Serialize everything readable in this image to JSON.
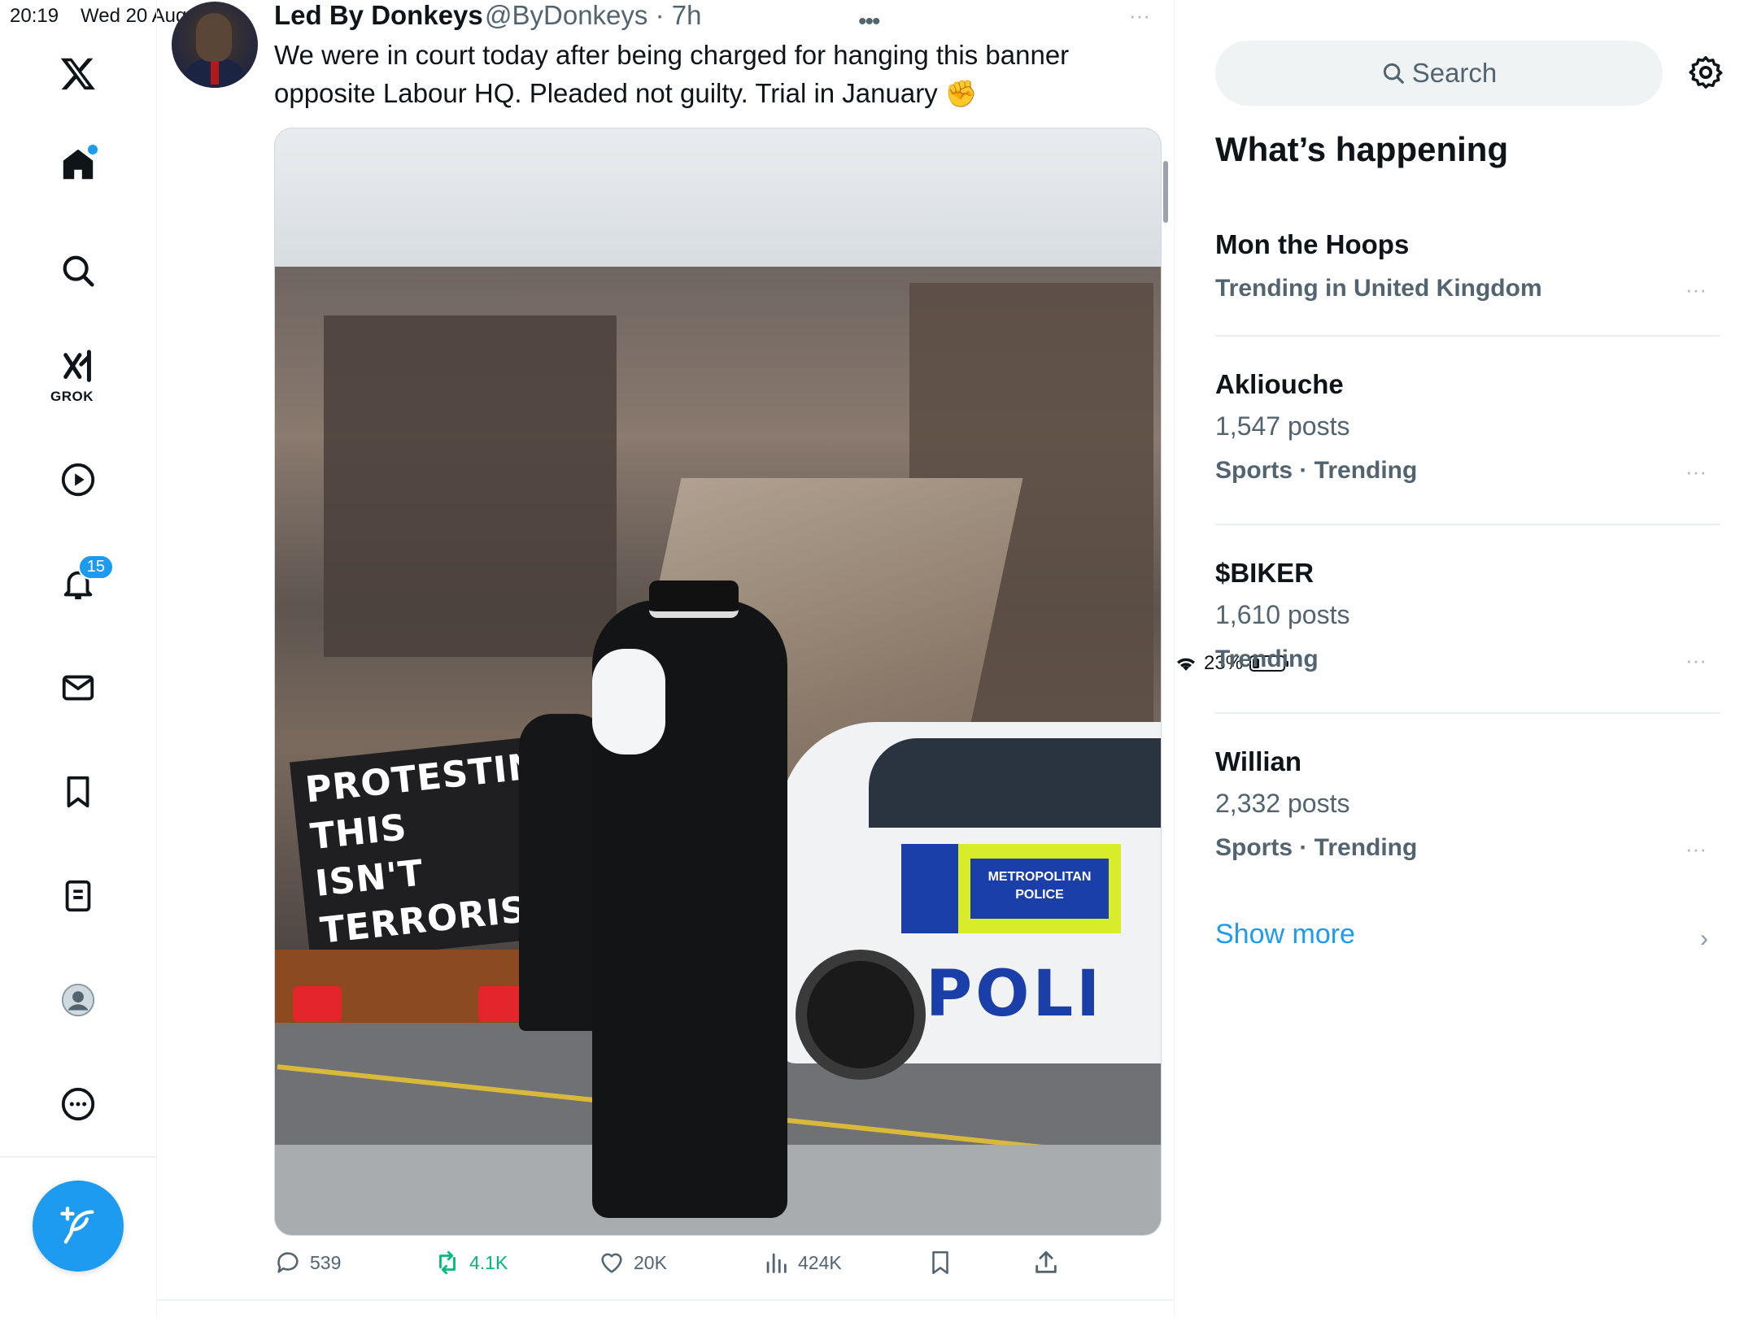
{
  "status_bar": {
    "time": "20:19",
    "date": "Wed 20 Aug",
    "battery": "23%",
    "battery_level": 0.23
  },
  "nav": {
    "grok_label": "GROK",
    "notifications_count": "15"
  },
  "tweet": {
    "name": "Led By Donkeys",
    "handle": "@ByDonkeys · 7h",
    "grok_dots": "•••",
    "more_dots": "···",
    "text": "We were in court today after being charged for hanging this banner opposite Labour HQ. Pleaded not guilty. Trial in January",
    "emoji": "✊",
    "image": {
      "banner_text_line1": "PROTESTING THIS",
      "banner_text_line2": "ISN'T TERRORISM",
      "car_badge_line1": "METROPOLITAN",
      "car_badge_line2": "POLICE",
      "car_text": "POLI"
    },
    "actions": {
      "replies": "539",
      "reposts": "4.1K",
      "likes": "20K",
      "views": "424K"
    }
  },
  "sidebar": {
    "search_placeholder": "Search",
    "section_title": "What’s happening",
    "trends": [
      {
        "name": "Mon the Hoops",
        "count": "",
        "category": "Trending in United Kingdom"
      },
      {
        "name": "Akliouche",
        "count": "1,547 posts",
        "category": "Sports · Trending"
      },
      {
        "name": "$BIKER",
        "count": "1,610 posts",
        "category": "Trending"
      },
      {
        "name": "Willian",
        "count": "2,332 posts",
        "category": "Sports · Trending"
      }
    ],
    "more_dots": "···",
    "show_more": "Show more",
    "chevron": "›"
  },
  "colors": {
    "accent": "#1d9bf0",
    "repost": "#00ba7c",
    "muted": "#536471"
  }
}
